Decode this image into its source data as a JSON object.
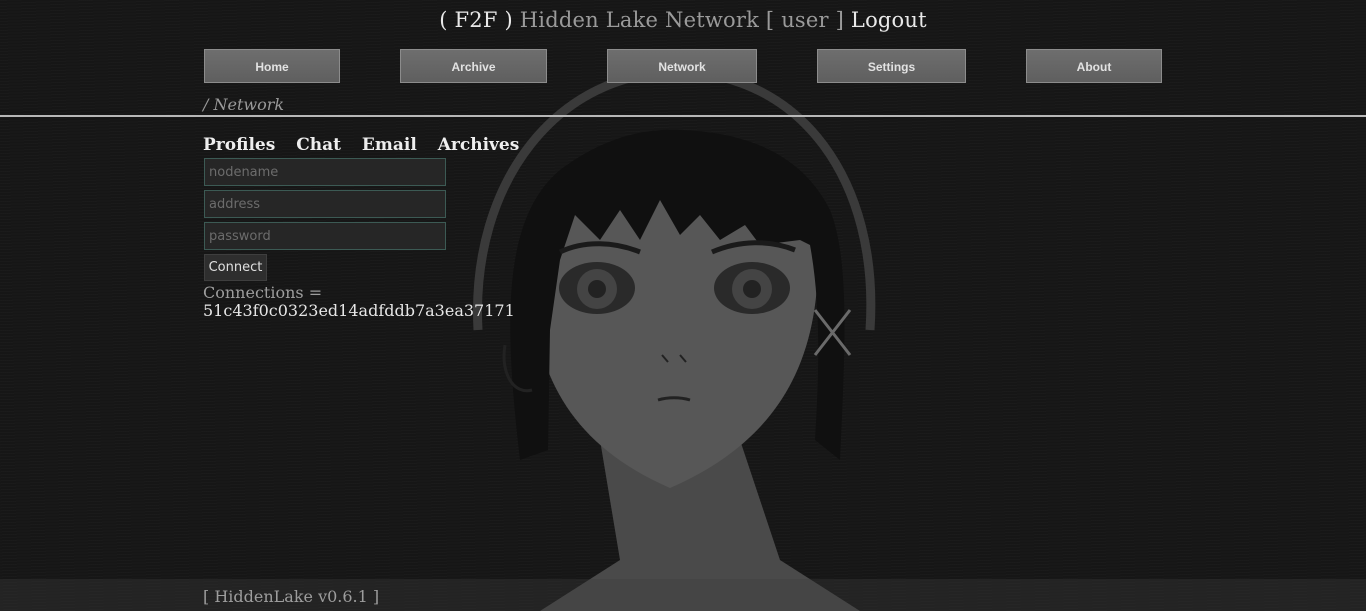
{
  "header": {
    "f2f_label": "( F2F )",
    "network_name": "Hidden Lake Network",
    "user_label": "[ user ]",
    "logout_label": "Logout"
  },
  "nav": {
    "home": "Home",
    "archive": "Archive",
    "network": "Network",
    "settings": "Settings",
    "about": "About"
  },
  "breadcrumb": "/ Network",
  "subtabs": {
    "profiles": "Profiles",
    "chat": "Chat",
    "email": "Email",
    "archives": "Archives"
  },
  "form": {
    "nodename_placeholder": "nodename",
    "address_placeholder": "address",
    "password_placeholder": "password",
    "connect_label": "Connect"
  },
  "connections": {
    "label": "Connections =",
    "values": [
      "51c43f0c0323ed14adfddb7a3ea37171"
    ]
  },
  "footer": "[ HiddenLake v0.6.1 ]",
  "background": {
    "icon": "anime-girl-portrait-artwork",
    "colors": {
      "page": "#161616",
      "button": "#666666",
      "divider": "#b8b8b8"
    }
  }
}
